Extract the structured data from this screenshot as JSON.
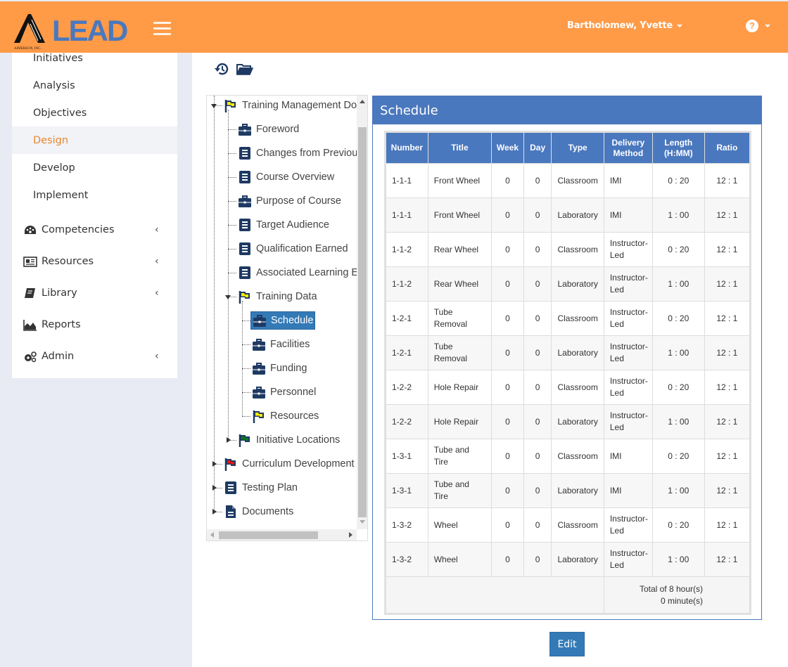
{
  "header": {
    "logo_text": "LEAD",
    "logo_company": "AIMEREON, INC.",
    "user_name": "Bartholomew, Yvette",
    "icons": {
      "menu": "hamburger-icon",
      "help": "question-circle-icon"
    },
    "help_glyph": "?",
    "brand_color": "#ff9a47",
    "logo_color": "#4a78be"
  },
  "sidebar": {
    "sub_items": [
      {
        "label": "Initiatives",
        "active": false
      },
      {
        "label": "Analysis",
        "active": false
      },
      {
        "label": "Objectives",
        "active": false
      },
      {
        "label": "Design",
        "active": true
      },
      {
        "label": "Develop",
        "active": false
      },
      {
        "label": "Implement",
        "active": false
      }
    ],
    "main_items": [
      {
        "label": "Competencies",
        "icon": "dashboard-icon",
        "expandable": true
      },
      {
        "label": "Resources",
        "icon": "newspaper-icon",
        "expandable": true
      },
      {
        "label": "Library",
        "icon": "book-icon",
        "expandable": true
      },
      {
        "label": "Reports",
        "icon": "area-chart-icon",
        "expandable": false
      },
      {
        "label": "Admin",
        "icon": "gears-icon",
        "expandable": true
      }
    ],
    "chevron_glyph": "‹",
    "active_color": "#e8862e"
  },
  "toolbar": {
    "icons": [
      "history-icon",
      "folder-open-icon"
    ]
  },
  "tree": {
    "nodes": [
      {
        "label": "Training Management Doc",
        "icon": "flag-yellow-icon",
        "level": 0,
        "state": "expanded"
      },
      {
        "label": "Foreword",
        "icon": "briefcase-icon",
        "level": 1
      },
      {
        "label": "Changes from Previous",
        "icon": "list-icon",
        "level": 1
      },
      {
        "label": "Course Overview",
        "icon": "list-icon",
        "level": 1
      },
      {
        "label": "Purpose of Course",
        "icon": "briefcase-icon",
        "level": 1
      },
      {
        "label": "Target Audience",
        "icon": "list-icon",
        "level": 1
      },
      {
        "label": "Qualification Earned",
        "icon": "list-icon",
        "level": 1
      },
      {
        "label": "Associated Learning Ev",
        "icon": "list-icon",
        "level": 1
      },
      {
        "label": "Training Data",
        "icon": "flag-yellow-icon",
        "level": 1,
        "state": "expanded"
      },
      {
        "label": "Schedule",
        "icon": "briefcase-icon",
        "level": 2,
        "selected": true
      },
      {
        "label": "Facilities",
        "icon": "briefcase-icon",
        "level": 2
      },
      {
        "label": "Funding",
        "icon": "briefcase-icon",
        "level": 2
      },
      {
        "label": "Personnel",
        "icon": "briefcase-icon",
        "level": 2
      },
      {
        "label": "Resources",
        "icon": "flag-yellow-icon",
        "level": 2
      },
      {
        "label": "Initiative Locations",
        "icon": "flag-green-icon",
        "level": 1,
        "state": "collapsed"
      },
      {
        "label": "Curriculum Development",
        "icon": "flag-red-icon",
        "level": 0,
        "state": "collapsed"
      },
      {
        "label": "Testing Plan",
        "icon": "list-icon",
        "level": 0,
        "state": "collapsed"
      },
      {
        "label": "Documents",
        "icon": "file-text-icon",
        "level": 0,
        "state": "collapsed"
      }
    ]
  },
  "schedule": {
    "title": "Schedule",
    "columns": [
      "Number",
      "Title",
      "Week",
      "Day",
      "Type",
      "Delivery Method",
      "Length (H:MM)",
      "Ratio"
    ],
    "rows": [
      [
        "1-1-1",
        "Front Wheel",
        "0",
        "0",
        "Classroom",
        "IMI",
        "0 : 20",
        "12 : 1"
      ],
      [
        "1-1-1",
        "Front Wheel",
        "0",
        "0",
        "Laboratory",
        "IMI",
        "1 : 00",
        "12 : 1"
      ],
      [
        "1-1-2",
        "Rear Wheel",
        "0",
        "0",
        "Classroom",
        "Instructor-Led",
        "0 : 20",
        "12 : 1"
      ],
      [
        "1-1-2",
        "Rear Wheel",
        "0",
        "0",
        "Laboratory",
        "Instructor-Led",
        "1 : 00",
        "12 : 1"
      ],
      [
        "1-2-1",
        "Tube Removal",
        "0",
        "0",
        "Classroom",
        "Instructor-Led",
        "0 : 20",
        "12 : 1"
      ],
      [
        "1-2-1",
        "Tube Removal",
        "0",
        "0",
        "Laboratory",
        "Instructor-Led",
        "1 : 00",
        "12 : 1"
      ],
      [
        "1-2-2",
        "Hole Repair",
        "0",
        "0",
        "Classroom",
        "Instructor-Led",
        "0 : 20",
        "12 : 1"
      ],
      [
        "1-2-2",
        "Hole Repair",
        "0",
        "0",
        "Laboratory",
        "Instructor-Led",
        "1 : 00",
        "12 : 1"
      ],
      [
        "1-3-1",
        "Tube and Tire",
        "0",
        "0",
        "Classroom",
        "IMI",
        "0 : 20",
        "12 : 1"
      ],
      [
        "1-3-1",
        "Tube and Tire",
        "0",
        "0",
        "Laboratory",
        "IMI",
        "1 : 00",
        "12 : 1"
      ],
      [
        "1-3-2",
        "Wheel",
        "0",
        "0",
        "Classroom",
        "Instructor-Led",
        "0 : 20",
        "12 : 1"
      ],
      [
        "1-3-2",
        "Wheel",
        "0",
        "0",
        "Laboratory",
        "Instructor-Led",
        "1 : 00",
        "12 : 1"
      ]
    ],
    "total_hours_text": "Total of 8 hour(s)",
    "total_minutes_text": "0 minute(s)",
    "header_color": "#4a78be",
    "edit_label": "Edit"
  }
}
